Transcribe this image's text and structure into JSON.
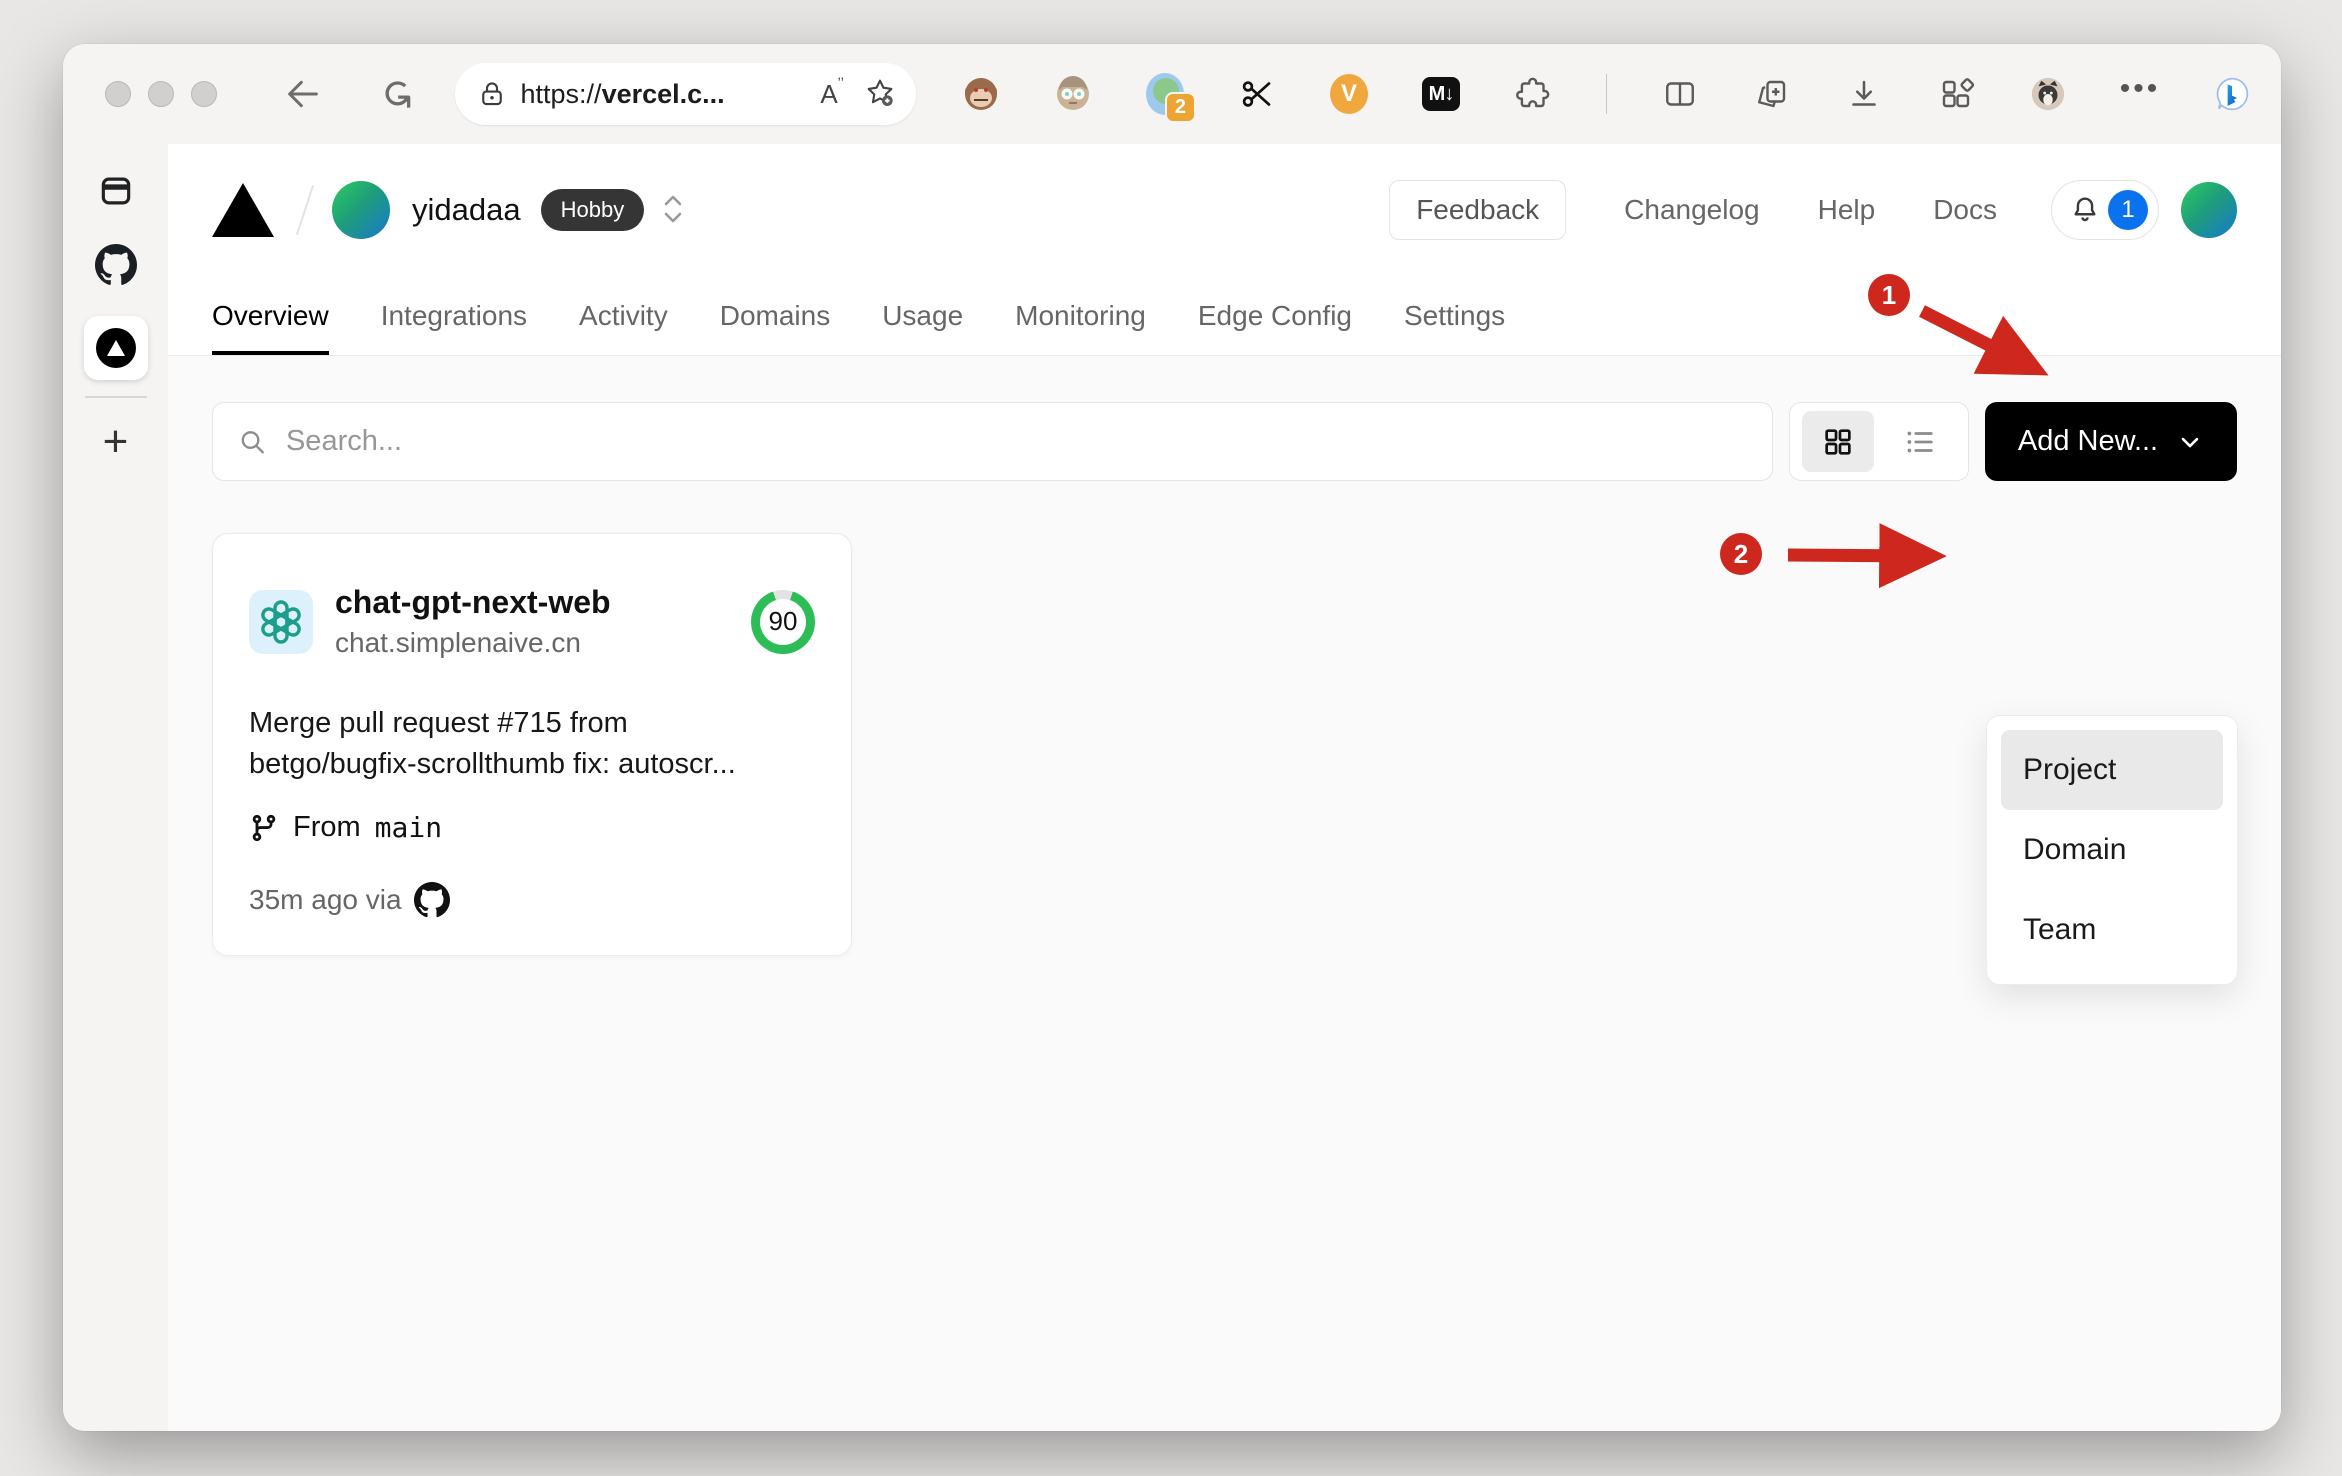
{
  "colors": {
    "annotation_red": "#ce271e",
    "accent_blue": "#0a72ef",
    "ring_green": "#2dbd56",
    "ring_track": "#e3e3e3",
    "button_black": "#000000",
    "badge_orange": "#eda433",
    "hobby_badge_bg": "#353535"
  },
  "browser": {
    "url": {
      "scheme": "https://",
      "host": "vercel.c..."
    },
    "extension_badge_count": "2",
    "markdown_ext_label": "M↓",
    "v_ext_label": "V",
    "ellipsis_label": "•••"
  },
  "header": {
    "team_name": "yidadaa",
    "plan_badge": "Hobby",
    "feedback_label": "Feedback",
    "links": [
      {
        "label": "Changelog"
      },
      {
        "label": "Help"
      },
      {
        "label": "Docs"
      }
    ],
    "notification_count": "1"
  },
  "tabs": [
    {
      "label": "Overview",
      "active": true
    },
    {
      "label": "Integrations"
    },
    {
      "label": "Activity"
    },
    {
      "label": "Domains"
    },
    {
      "label": "Usage"
    },
    {
      "label": "Monitoring"
    },
    {
      "label": "Edge Config"
    },
    {
      "label": "Settings"
    }
  ],
  "controls": {
    "search_placeholder": "Search...",
    "add_new_label": "Add New..."
  },
  "dropdown": {
    "items": [
      {
        "label": "Project",
        "highlighted": true
      },
      {
        "label": "Domain"
      },
      {
        "label": "Team"
      }
    ]
  },
  "project_card": {
    "name": "chat-gpt-next-web",
    "domain": "chat.simplenaive.cn",
    "score": "90",
    "commit_line1": "Merge pull request #715 from",
    "commit_line2": "betgo/bugfix-scrollthumb fix: autoscr...",
    "branch_prefix": "From",
    "branch_name": "main",
    "time_text": "35m ago via"
  },
  "annotations": {
    "step1": "1",
    "step2": "2"
  }
}
